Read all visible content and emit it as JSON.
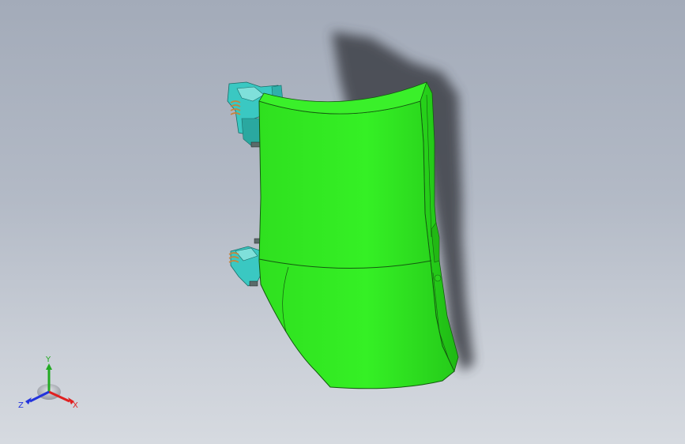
{
  "triad": {
    "x_label": "X",
    "y_label": "Y",
    "z_label": "Z"
  },
  "colors": {
    "part": "#33ee22",
    "part_shade": "#22c818",
    "bracket": "#35c8c0",
    "spring": "#c8843a",
    "shadow": "#3c3f46",
    "axis_x": "#e02020",
    "axis_y": "#22aa22",
    "axis_z": "#2233dd"
  }
}
